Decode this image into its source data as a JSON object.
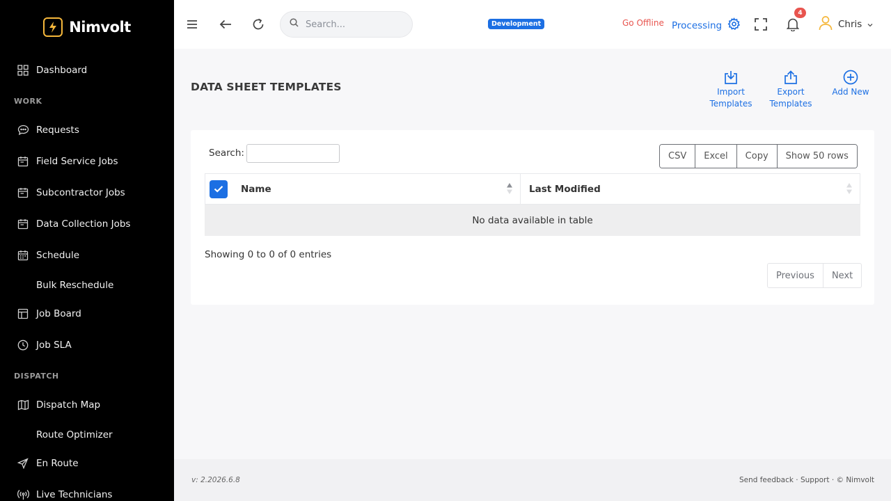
{
  "brand": {
    "name": "Nimvolt",
    "accent": "#f5b73b"
  },
  "sidebar": {
    "sections": {
      "work": "WORK",
      "dispatch": "DISPATCH"
    },
    "items": [
      {
        "label": "Dashboard",
        "icon": "grid-icon"
      },
      {
        "label": "Requests",
        "icon": "chat-bubble-icon"
      },
      {
        "label": "Field Service Jobs",
        "icon": "calendar-icon"
      },
      {
        "label": "Subcontractor Jobs",
        "icon": "calendar-icon"
      },
      {
        "label": "Data Collection Jobs",
        "icon": "calendar-icon"
      },
      {
        "label": "Schedule",
        "icon": "calendar-grid-icon"
      },
      {
        "label": "Bulk Reschedule",
        "icon": ""
      },
      {
        "label": "Job Board",
        "icon": "board-icon"
      },
      {
        "label": "Job SLA",
        "icon": "clock-icon"
      },
      {
        "label": "Dispatch Map",
        "icon": "map-icon"
      },
      {
        "label": "Route Optimizer",
        "icon": ""
      },
      {
        "label": "En Route",
        "icon": "send-icon"
      },
      {
        "label": "Live Technicians",
        "icon": "antenna-icon"
      }
    ]
  },
  "topbar": {
    "search_placeholder": "Search...",
    "environment": "Development",
    "go_offline": "Go Offline",
    "processing": "Processing",
    "notification_count": "4",
    "user_name": "Chris"
  },
  "page": {
    "title": "DATA SHEET TEMPLATES",
    "actions": {
      "import": "Import Templates",
      "export": "Export Templates",
      "add_new": "Add New"
    }
  },
  "table": {
    "search_label": "Search:",
    "buttons": [
      "CSV",
      "Excel",
      "Copy",
      "Show 50 rows"
    ],
    "columns": [
      "Name",
      "Last Modified"
    ],
    "empty_message": "No data available in table",
    "info": "Showing 0 to 0 of 0 entries",
    "pager": {
      "previous": "Previous",
      "next": "Next"
    }
  },
  "footer": {
    "version": "v: 2.2026.6.8",
    "links": "Send feedback · Support · © Nimvolt"
  },
  "colors": {
    "primary": "#1c6fe3",
    "danger": "#e8544e",
    "sidebar_bg": "#000000"
  }
}
